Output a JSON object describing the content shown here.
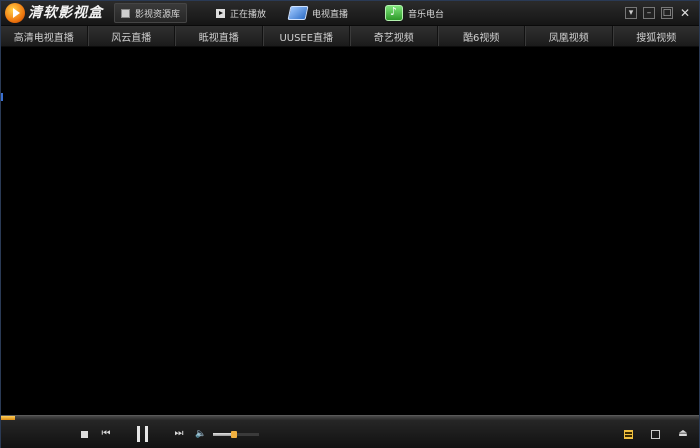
{
  "app": {
    "brand": "清软影视盒"
  },
  "nav": {
    "tabs": [
      {
        "label": "影视资源库",
        "icon": "library-icon",
        "active": true
      },
      {
        "label": "正在播放",
        "icon": "play-icon",
        "active": false
      },
      {
        "label": "电视直播",
        "icon": "tv-icon",
        "active": false
      },
      {
        "label": "音乐电台",
        "icon": "music-icon",
        "active": false
      }
    ]
  },
  "window_controls": {
    "menu": "▾",
    "minimize": "–",
    "maximize": "□",
    "close": "✕"
  },
  "channels": [
    "高清电视直播",
    "风云直播",
    "眡视直播",
    "UUSEE直播",
    "奇艺视频",
    "酷6视频",
    "凤凰视频",
    "搜狐视频"
  ],
  "player": {
    "progress_percent": 2,
    "volume_percent": 45,
    "prev_glyph": "⏮",
    "next_glyph": "⏭",
    "volume_glyph": "🔈",
    "eject_glyph": "⏏"
  },
  "colors": {
    "accent": "#f0a830",
    "background": "#000000",
    "bar": "#1b1b1b"
  }
}
